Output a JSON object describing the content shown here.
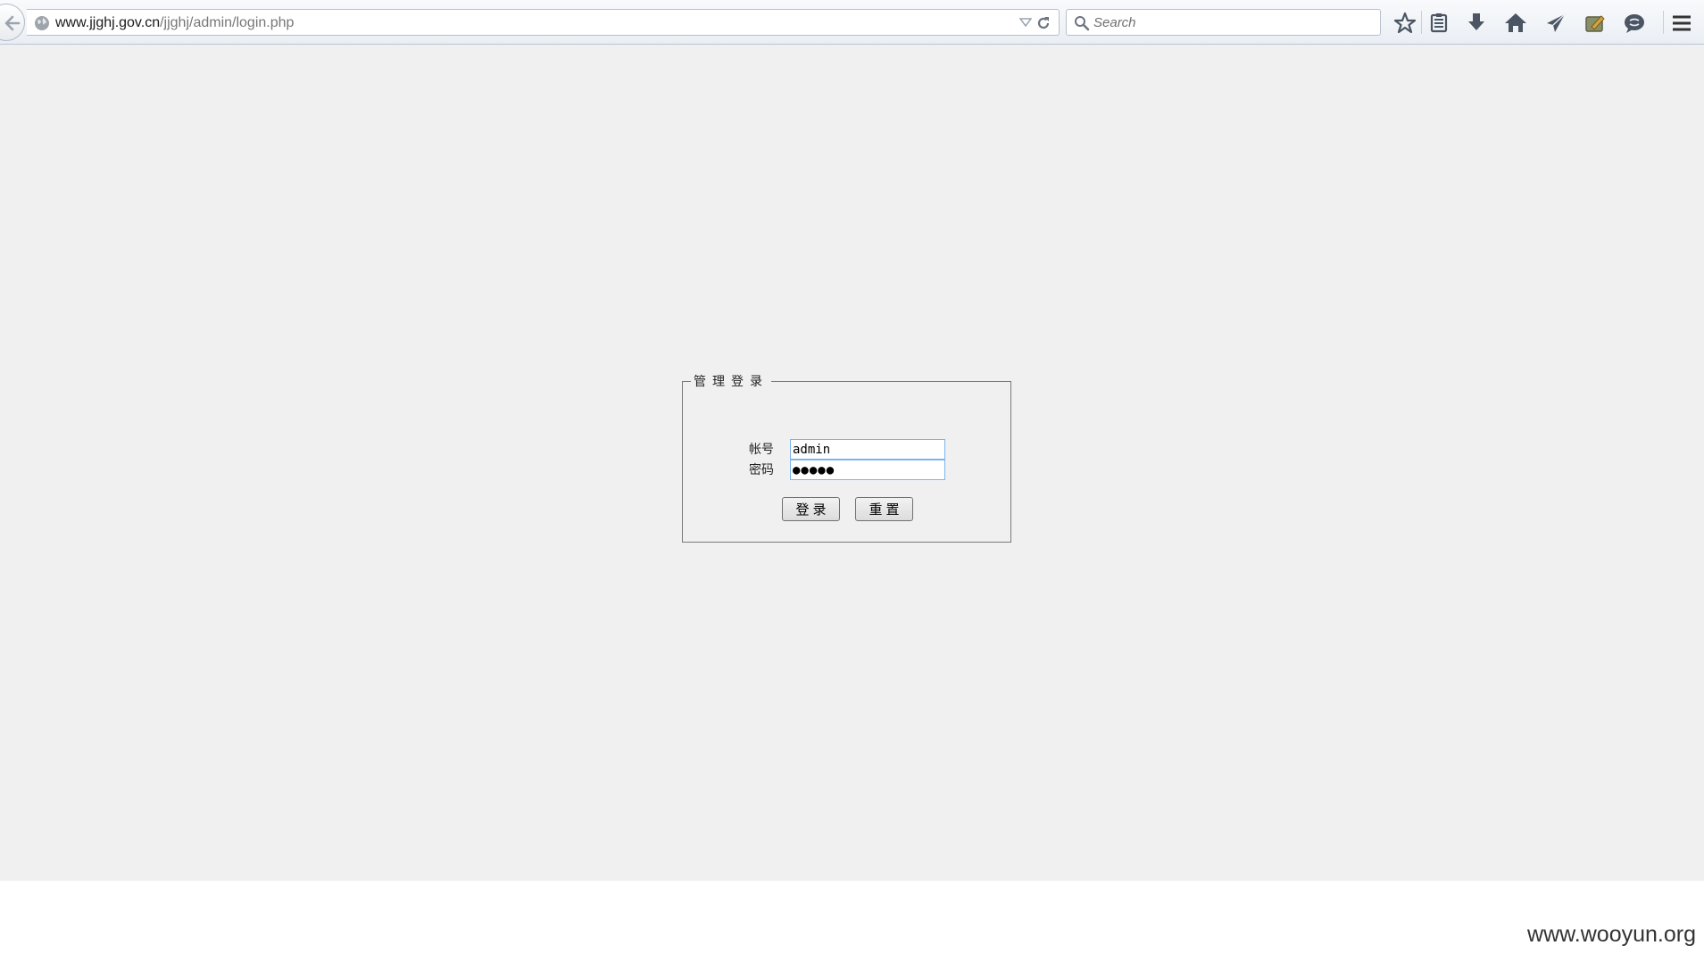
{
  "browser": {
    "url_host": "www.jjghj.gov.cn",
    "url_path": "/jjghj/admin/login.php",
    "search_placeholder": "Search"
  },
  "login": {
    "legend": "管理登录",
    "username_label": "帐号",
    "username_value": "admin",
    "password_label": "密码",
    "password_value": "●●●●●",
    "login_button": "登录",
    "reset_button": "重置"
  },
  "watermark": "www.wooyun.org",
  "colors": {
    "page_background": "#f0f0f0",
    "toolbar_background": "#eaeef4",
    "input_border": "#7eb4ea",
    "fieldset_border": "#7a7a7a"
  }
}
